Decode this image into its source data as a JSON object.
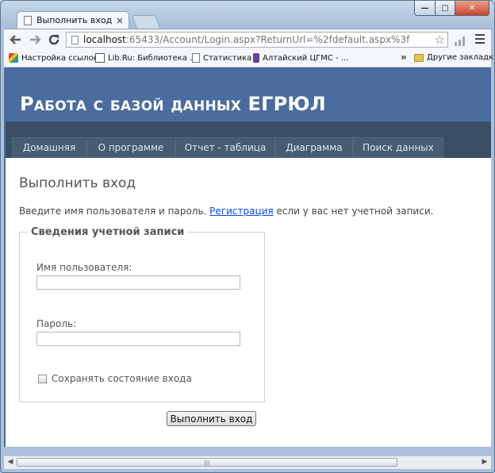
{
  "browser": {
    "tab_title": "Выполнить вход",
    "tab_close": "×",
    "window_controls": {
      "minimize": "—",
      "maximize": "□",
      "close": "✕"
    },
    "url_host": "localhost",
    "url_path": ":65433/Account/Login.aspx?ReturnUrl=%2fdefault.aspx%3f",
    "back_icon": "arrow-left-icon",
    "forward_icon": "arrow-right-icon",
    "reload_icon": "reload-icon",
    "bookmarks": [
      {
        "label": "Настройка ссылок",
        "icon": "google-icon"
      },
      {
        "label": "Lib.Ru: Библиотека ...",
        "icon": "lib-icon"
      },
      {
        "label": "Статистика",
        "icon": "page-icon"
      },
      {
        "label": "Алтайский ЦГМС - ...",
        "icon": "bookmark-icon"
      }
    ],
    "bookmarks_more": "»",
    "other_bookmarks": "Другие закладки"
  },
  "site": {
    "title": "Работа с базой данных ЕГРЮЛ",
    "menu": [
      {
        "label": "Домашняя"
      },
      {
        "label": "О программе"
      },
      {
        "label": "Отчет - таблица"
      },
      {
        "label": "Диаграмма"
      },
      {
        "label": "Поиск данных"
      }
    ]
  },
  "login": {
    "heading": "Выполнить вход",
    "intro_before": "Введите имя пользователя и пароль. ",
    "register_link": "Регистрация",
    "intro_after": " если у вас нет учетной записи.",
    "legend": "Сведения учетной записи",
    "username_label": "Имя пользователя:",
    "username_value": "",
    "password_label": "Пароль:",
    "password_value": "",
    "remember_label": "Сохранять состояние входа",
    "remember_checked": false,
    "submit_label": "Выполнить вход"
  },
  "scrollbar": {
    "grip": "|||"
  }
}
